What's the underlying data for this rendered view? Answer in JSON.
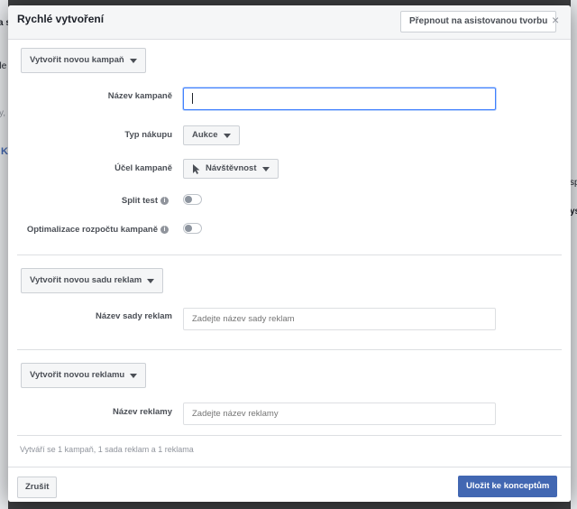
{
  "background": {
    "frag_a": "a s",
    "frag_k": "K",
    "frag_y": "y,",
    "frag_ale": "ale",
    "frag_sp": "sp",
    "frag_ys": "ys"
  },
  "modal": {
    "title": "Rychlé vytvoření",
    "switch_label": "Přepnout na asistovanou tvorbu",
    "close_glyph": "×"
  },
  "campaign": {
    "section_button": "Vytvořit novou kampaň",
    "name_label": "Název kampaně",
    "name_value": "",
    "purchase_type_label": "Typ nákupu",
    "purchase_type_value": "Aukce",
    "objective_label": "Účel kampaně",
    "objective_value": "Návštěvnost",
    "split_test_label": "Split test",
    "budget_opt_label": "Optimalizace rozpočtu kampaně",
    "split_test_on": false,
    "budget_opt_on": false
  },
  "adset": {
    "section_button": "Vytvořit novou sadu reklam",
    "name_label": "Název sady reklam",
    "name_placeholder": "Zadejte název sady reklam"
  },
  "ad": {
    "section_button": "Vytvořit novou reklamu",
    "name_label": "Název reklamy",
    "name_placeholder": "Zadejte název reklamy"
  },
  "summary": "Vytváří se 1 kampaň, 1 sada reklam a 1 reklama",
  "footer": {
    "cancel": "Zrušit",
    "save": "Uložit ke konceptům"
  },
  "colors": {
    "primary": "#4267b2",
    "focus": "#4080ff"
  }
}
